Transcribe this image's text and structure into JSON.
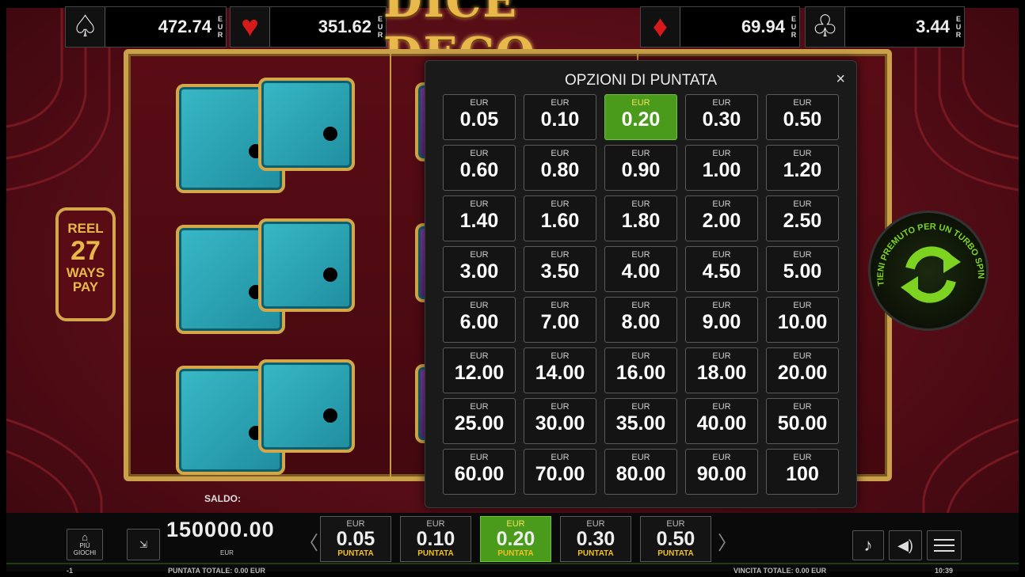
{
  "jackpots": [
    {
      "suit": "spade",
      "symbol": "♤",
      "amount": "472.74",
      "currency": [
        "E",
        "U",
        "R"
      ]
    },
    {
      "suit": "heart",
      "symbol": "♥",
      "amount": "351.62",
      "currency": [
        "E",
        "U",
        "R"
      ]
    },
    {
      "suit": "diamond",
      "symbol": "♦",
      "amount": "69.94",
      "currency": [
        "E",
        "U",
        "R"
      ]
    },
    {
      "suit": "club",
      "symbol": "♧",
      "amount": "3.44",
      "currency": [
        "E",
        "U",
        "R"
      ]
    }
  ],
  "logo": "DICE DECO",
  "reel_badge": {
    "line1": "REEL",
    "line2": "27",
    "line3": "WAYS",
    "line4": "PAY"
  },
  "turbo": {
    "text": "TIENI PREMUTO PER UN TURBO SPIN"
  },
  "bet_modal": {
    "title": "OPZIONI DI PUNTATA",
    "close": "×",
    "currency": "EUR",
    "selected": "0.20",
    "options": [
      "0.05",
      "0.10",
      "0.20",
      "0.30",
      "0.50",
      "0.60",
      "0.80",
      "0.90",
      "1.00",
      "1.20",
      "1.40",
      "1.60",
      "1.80",
      "2.00",
      "2.50",
      "3.00",
      "3.50",
      "4.00",
      "4.50",
      "5.00",
      "6.00",
      "7.00",
      "8.00",
      "9.00",
      "10.00",
      "12.00",
      "14.00",
      "16.00",
      "18.00",
      "20.00",
      "25.00",
      "30.00",
      "35.00",
      "40.00",
      "50.00",
      "60.00",
      "70.00",
      "80.00",
      "90.00",
      "100"
    ]
  },
  "bottom": {
    "saldo_label": "SALDO:",
    "more_games": "PIÙ GIOCHI",
    "balance": "150000.00",
    "balance_currency": "EUR",
    "quick_bets": [
      {
        "currency": "EUR",
        "value": "0.05",
        "label": "PUNTATA"
      },
      {
        "currency": "EUR",
        "value": "0.10",
        "label": "PUNTATA"
      },
      {
        "currency": "EUR",
        "value": "0.20",
        "label": "PUNTATA",
        "selected": true
      },
      {
        "currency": "EUR",
        "value": "0.30",
        "label": "PUNTATA"
      },
      {
        "currency": "EUR",
        "value": "0.50",
        "label": "PUNTATA"
      }
    ],
    "prev_arrow": "〈",
    "next_arrow": "〉",
    "round_id": "-1",
    "total_bet": "PUNTATA TOTALE: 0.00 EUR",
    "total_win": "VINCITA TOTALE: 0.00 EUR",
    "clock": "10:39"
  },
  "colors": {
    "accent_gold": "#d4a84a",
    "selected_green": "#4a9a1c",
    "background_red": "#5c0e18",
    "die_teal": "#2aa4b4"
  }
}
